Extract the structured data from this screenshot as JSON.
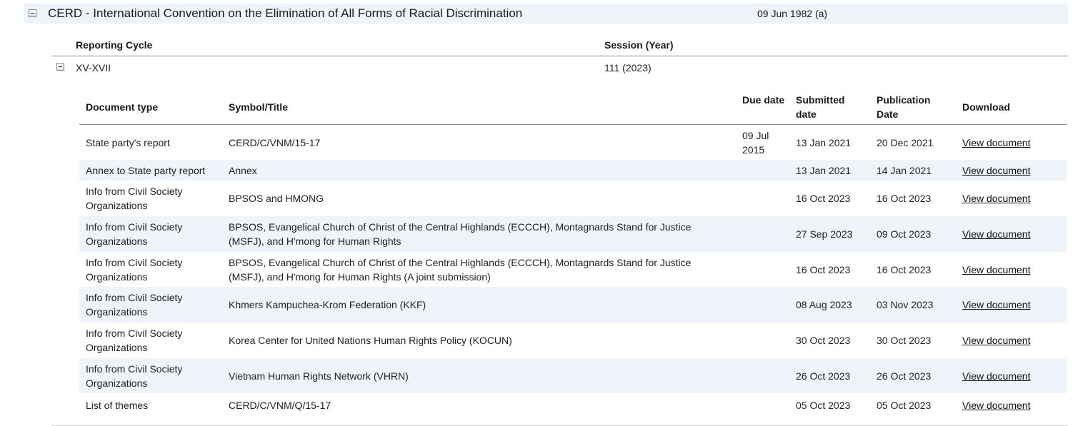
{
  "treaty": {
    "title": "CERD - International Convention on the Elimination of All Forms of Racial Discrimination",
    "date": "09 Jun 1982 (a)"
  },
  "cycle_table": {
    "headers": {
      "cycle": "Reporting Cycle",
      "session": "Session (Year)"
    },
    "row": {
      "cycle": "XV-XVII",
      "session": "111 (2023)"
    }
  },
  "doc_table": {
    "headers": {
      "type": "Document type",
      "symbol": "Symbol/Title",
      "due": "Due date",
      "submitted": "Submitted date",
      "publication": "Publication Date",
      "download": "Download"
    },
    "rows": [
      {
        "type": "State party's report",
        "symbol": "CERD/C/VNM/15-17",
        "due": "09 Jul 2015",
        "submitted": "13 Jan 2021",
        "publication": "20 Dec 2021",
        "download": "View document"
      },
      {
        "type": "Annex to State party report",
        "symbol": "Annex",
        "due": "",
        "submitted": "13 Jan 2021",
        "publication": "14 Jan 2021",
        "download": "View document"
      },
      {
        "type": "Info from Civil Society Organizations",
        "symbol": "BPSOS and HMONG",
        "due": "",
        "submitted": "16 Oct 2023",
        "publication": "16 Oct 2023",
        "download": "View document"
      },
      {
        "type": "Info from Civil Society Organizations",
        "symbol": "BPSOS, Evangelical Church of Christ of the Central Highlands (ECCCH), Montagnards Stand for Justice (MSFJ), and H'mong for Human Rights",
        "due": "",
        "submitted": "27 Sep 2023",
        "publication": "09 Oct 2023",
        "download": "View document"
      },
      {
        "type": "Info from Civil Society Organizations",
        "symbol": "BPSOS, Evangelical Church of Christ of the Central Highlands (ECCCH), Montagnards Stand for Justice (MSFJ), and H'mong for Human Rights (A joint submission)",
        "due": "",
        "submitted": "16 Oct 2023",
        "publication": "16 Oct 2023",
        "download": "View document"
      },
      {
        "type": "Info from Civil Society Organizations",
        "symbol": "Khmers Kampuchea-Krom Federation (KKF)",
        "due": "",
        "submitted": "08 Aug 2023",
        "publication": "03 Nov 2023",
        "download": "View document"
      },
      {
        "type": "Info from Civil Society Organizations",
        "symbol": "Korea Center for United Nations Human Rights Policy (KOCUN)",
        "due": "",
        "submitted": "30 Oct 2023",
        "publication": "30 Oct 2023",
        "download": "View document"
      },
      {
        "type": "Info from Civil Society Organizations",
        "symbol": "Vietnam Human Rights Network (VHRN)",
        "due": "",
        "submitted": "26 Oct 2023",
        "publication": "26 Oct 2023",
        "download": "View document"
      },
      {
        "type": "List of themes",
        "symbol": "CERD/C/VNM/Q/15-17",
        "due": "",
        "submitted": "05 Oct 2023",
        "publication": "05 Oct 2023",
        "download": "View document"
      }
    ]
  }
}
